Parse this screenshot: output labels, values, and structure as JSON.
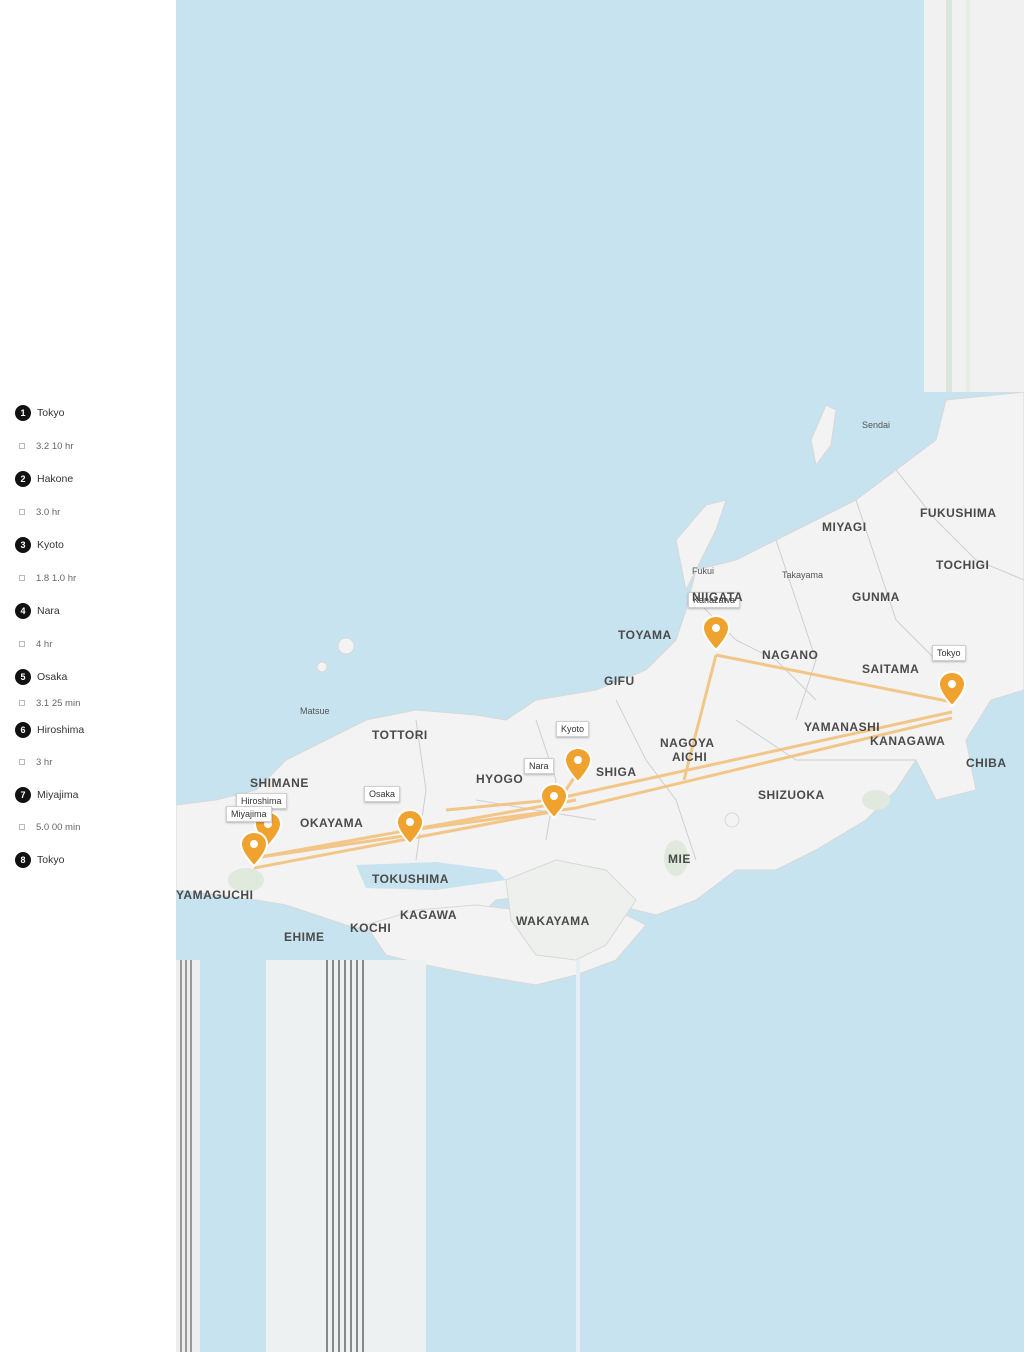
{
  "sidebar": {
    "stops": [
      {
        "num": "1",
        "label": "Tokyo"
      },
      {
        "num": "2",
        "label": "Hakone"
      },
      {
        "num": "3",
        "label": "Kyoto"
      },
      {
        "num": "4",
        "label": "Nara"
      },
      {
        "num": "5",
        "label": "Osaka"
      },
      {
        "num": "6",
        "label": "Hiroshima"
      },
      {
        "num": "7",
        "label": "Miyajima"
      },
      {
        "num": "8",
        "label": "Tokyo"
      }
    ],
    "legs": [
      "3.2 10 hr",
      "3.0 hr",
      "1.8 1.0 hr",
      "4 hr",
      "3.1 25 min",
      "3 hr",
      "5.0 00 min"
    ]
  },
  "map": {
    "pins": [
      {
        "label": "Tokyo"
      },
      {
        "label": "Kanazawa"
      },
      {
        "label": "Kyoto"
      },
      {
        "label": "Nara"
      },
      {
        "label": "Osaka"
      },
      {
        "label": "Hiroshima"
      },
      {
        "label": "Miyajima"
      }
    ],
    "regions": [
      "MIYAGI",
      "FUKUSHIMA",
      "TOCHIGI",
      "NIIGATA",
      "GUNMA",
      "SAITAMA",
      "NAGANO",
      "TOYAMA",
      "GIFU",
      "YAMANASHI",
      "NAGOYA",
      "AICHI",
      "KANAGAWA",
      "SHIZUOKA",
      "CHIBA",
      "SHIGA",
      "MIE",
      "WAKAYAMA",
      "HYOGO",
      "OKAYAMA",
      "SHIMANE",
      "TOTTORI",
      "EHIME",
      "KAGAWA",
      "TOKUSHIMA",
      "KOCHI",
      "YAMAGUCHI"
    ],
    "small_places": [
      "Fukui",
      "Takayama",
      "Matsue",
      "Sendai"
    ],
    "colors": {
      "sea": "#c6e3ef",
      "land": "#f3f3f3",
      "route": "#f2c27d",
      "pin": "#f0a22e"
    }
  }
}
